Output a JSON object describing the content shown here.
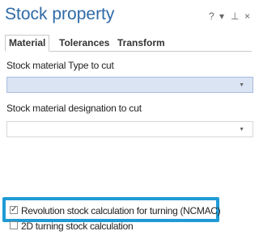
{
  "panel": {
    "title": "Stock property",
    "help_icon": "?",
    "dropdown_icon": "▾",
    "pin_icon": "⊥",
    "close_icon": "×"
  },
  "tabs": [
    {
      "label": "Material",
      "active": true
    },
    {
      "label": "Tolerances",
      "active": false
    },
    {
      "label": "Transform",
      "active": false
    }
  ],
  "fields": {
    "type_to_cut_label": "Stock material Type to cut",
    "type_to_cut_value": "",
    "designation_label": "Stock material designation to cut",
    "designation_value": ""
  },
  "options": {
    "revolution_label": "Revolution stock calculation for turning (NCMAC)",
    "revolution_checked": true,
    "turning2d_label": "2D turning stock calculation",
    "turning2d_checked": false
  },
  "colors": {
    "title": "#2e6aa7",
    "highlight": "#1e9bd6",
    "combo_selected": "#dbe4f3"
  }
}
